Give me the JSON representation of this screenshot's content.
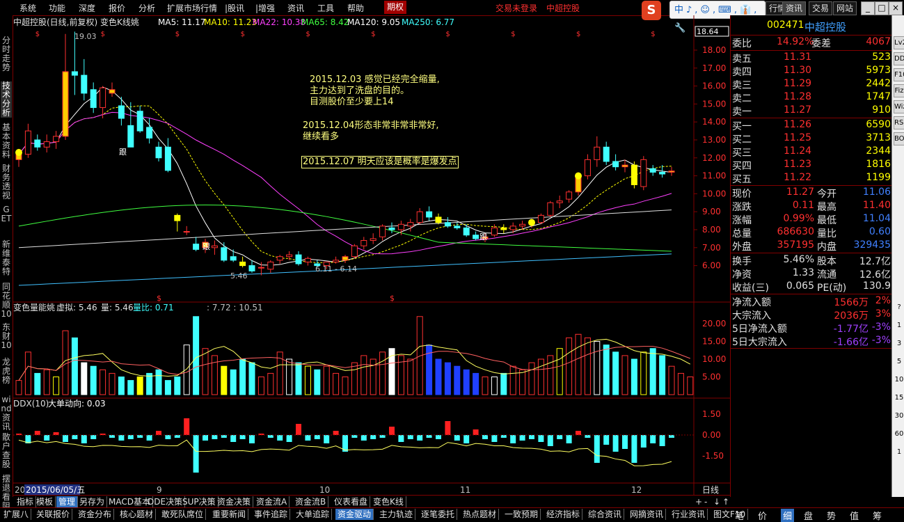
{
  "menu": {
    "items": [
      "系统",
      "功能",
      "深度",
      "报价",
      "分析",
      "扩展市场行情",
      "|股讯",
      "|增强",
      "资讯",
      "工具",
      "帮助"
    ],
    "futures": "期权",
    "status": "交易未登录",
    "stock_name": "中超控股",
    "ime": "中♪,☺,⌨,👔,🔧",
    "tabs": [
      "行情",
      "资讯",
      "交易",
      "网站"
    ],
    "win_buttons": [
      "_",
      "□",
      "×"
    ]
  },
  "left_tabs": [
    "分时走势",
    "技术分析",
    "基本资料",
    "财务透视",
    "GET",
    "新维泰特",
    "同花顺10",
    "东财10",
    "龙虎榜",
    "wind资讯",
    "散户查股",
    "摆退看阻"
  ],
  "main_chart": {
    "title": "中超控股(日线,前复权) 变色K线姚",
    "ma": [
      {
        "label": "MA5: 11.17",
        "color": "#ffffff"
      },
      {
        "label": "MA10: 11.23",
        "color": "#ffff00"
      },
      {
        "label": "MA22: 10.38",
        "color": "#ff40ff"
      },
      {
        "label": "MA65: 8.42",
        "color": "#40ff40"
      },
      {
        "label": "MA120: 9.05",
        "color": "#ffffff"
      },
      {
        "label": "MA250: 6.77",
        "color": "#40ffff"
      }
    ],
    "price_box": "18.64",
    "high_label": "19.03",
    "low_label": "5.46",
    "low2_label": "6.11 - 6.14",
    "follow_label": "跟",
    "y_ticks": [
      "18.00",
      "17.00",
      "16.00",
      "15.00",
      "14.00",
      "13.00",
      "12.00",
      "11.00",
      "10.00",
      "9.00",
      "8.00",
      "7.00",
      "6.00"
    ],
    "annotations": [
      {
        "lines": [
          "2015.12.03 感觉已经完全缩量,",
          "主力达到了洗盘的目的。",
          "目测股价至少要上14"
        ]
      },
      {
        "lines": [
          "2015.12.04形态非常非常非常好,",
          "继续看多"
        ]
      },
      {
        "lines": [
          "2015.12.07 明天应该是概率是爆发点"
        ]
      }
    ]
  },
  "volume_chart": {
    "title": "变色量能姚",
    "virtual": "虚拟: 5.46",
    "vol": "量: 5.46",
    "ratio": "量比: 0.71",
    "extra": ": 7.72 : 10.51",
    "y_ticks": [
      "20.00",
      "15.00",
      "10.00",
      "5.00"
    ]
  },
  "ddx_chart": {
    "title": "DDX(10)",
    "big": "大单动向: 0.03",
    "y_ticks": [
      "1.50",
      "0.00",
      "-1.50"
    ]
  },
  "x_axis": {
    "start": "20",
    "date": "2015/06/05/五",
    "months": [
      "9",
      "10",
      "11",
      "12"
    ],
    "period": "日线"
  },
  "chart_data": {
    "type": "candlestick",
    "title": "中超控股(日线,前复权) 变色K线姚",
    "ylim": [
      5.4,
      18.6
    ],
    "candles": [
      [
        11.9,
        12.5,
        11.5,
        12.2
      ],
      [
        12.2,
        13.9,
        12.0,
        13.5
      ],
      [
        13.0,
        13.3,
        12.4,
        12.6
      ],
      [
        12.6,
        13.3,
        12.3,
        12.9
      ],
      [
        12.9,
        13.5,
        12.5,
        13.2
      ],
      [
        13.2,
        18.9,
        13.0,
        16.8
      ],
      [
        16.8,
        19.03,
        15.5,
        16.6
      ],
      [
        16.6,
        17.5,
        15.2,
        15.6
      ],
      [
        15.8,
        16.2,
        14.5,
        14.8
      ],
      [
        14.8,
        16.0,
        14.2,
        15.9
      ],
      [
        15.6,
        16.2,
        15.4,
        15.8
      ],
      [
        14.9,
        15.4,
        13.8,
        14.2
      ],
      [
        13.8,
        15.1,
        12.7,
        12.6
      ],
      [
        14.6,
        14.9,
        13.4,
        13.5
      ],
      [
        13.7,
        14.2,
        12.8,
        13.1
      ],
      [
        12.6,
        12.9,
        11.8,
        12.0
      ],
      [
        12.6,
        13.1,
        11.2,
        11.3
      ],
      [
        8.8,
        8.9,
        7.9,
        8.5
      ],
      [
        7.9,
        8.2,
        7.7,
        7.9
      ],
      [
        7.2,
        7.6,
        6.8,
        6.9
      ],
      [
        7.0,
        7.5,
        6.7,
        7.3
      ],
      [
        7.0,
        7.4,
        6.6,
        7.1
      ],
      [
        7.0,
        7.3,
        6.2,
        6.3
      ],
      [
        6.5,
        6.9,
        6.2,
        6.3
      ],
      [
        6.2,
        6.5,
        5.9,
        6.0
      ],
      [
        6.0,
        6.3,
        5.6,
        5.7
      ],
      [
        5.9,
        6.2,
        5.46,
        5.9
      ],
      [
        5.8,
        6.3,
        5.6,
        6.2
      ],
      [
        6.3,
        6.6,
        6.1,
        6.5
      ],
      [
        6.5,
        6.8,
        6.3,
        6.6
      ],
      [
        6.6,
        6.8,
        6.0,
        6.1
      ],
      [
        6.2,
        6.5,
        6.0,
        6.4
      ],
      [
        6.1,
        6.3,
        5.9,
        6.0
      ],
      [
        6.0,
        6.2,
        5.8,
        6.2
      ],
      [
        6.2,
        6.5,
        6.11,
        6.3
      ],
      [
        6.3,
        6.6,
        6.14,
        6.5
      ],
      [
        6.5,
        7.2,
        6.4,
        7.1
      ],
      [
        7.1,
        7.6,
        6.9,
        7.4
      ],
      [
        7.4,
        7.8,
        7.2,
        7.5
      ],
      [
        7.6,
        8.3,
        7.4,
        8.2
      ],
      [
        8.1,
        8.4,
        7.8,
        8.0
      ],
      [
        8.0,
        8.5,
        7.7,
        8.3
      ],
      [
        8.2,
        8.6,
        7.9,
        8.4
      ],
      [
        8.4,
        9.2,
        8.3,
        9.0
      ],
      [
        9.0,
        9.3,
        8.5,
        8.7
      ],
      [
        8.7,
        8.9,
        8.3,
        8.4
      ],
      [
        8.4,
        8.7,
        8.1,
        8.2
      ],
      [
        8.2,
        8.4,
        8.0,
        8.1
      ],
      [
        8.1,
        8.3,
        7.6,
        7.7
      ],
      [
        7.7,
        7.9,
        7.4,
        7.5
      ],
      [
        7.5,
        7.8,
        7.3,
        7.6
      ],
      [
        7.7,
        8.3,
        7.6,
        8.1
      ],
      [
        8.1,
        8.3,
        7.8,
        8.0
      ],
      [
        8.0,
        8.4,
        7.8,
        8.2
      ],
      [
        8.2,
        8.5,
        8.0,
        8.3
      ],
      [
        8.3,
        8.6,
        8.1,
        8.4
      ],
      [
        8.4,
        8.9,
        8.3,
        8.8
      ],
      [
        8.8,
        9.6,
        8.7,
        9.5
      ],
      [
        9.5,
        9.9,
        9.2,
        9.6
      ],
      [
        9.7,
        10.2,
        9.5,
        10.1
      ],
      [
        10.1,
        11.2,
        9.9,
        11.0
      ],
      [
        11.0,
        12.2,
        10.8,
        11.9
      ],
      [
        11.9,
        13.2,
        11.5,
        12.6
      ],
      [
        12.6,
        12.9,
        11.6,
        11.8
      ],
      [
        11.8,
        12.2,
        11.3,
        11.5
      ],
      [
        11.5,
        11.9,
        11.2,
        11.6
      ],
      [
        11.6,
        11.8,
        10.3,
        10.5
      ],
      [
        10.4,
        12.1,
        10.2,
        11.9
      ],
      [
        11.4,
        11.6,
        11.0,
        11.2
      ],
      [
        11.2,
        11.6,
        10.9,
        11.1
      ],
      [
        11.2,
        11.5,
        11.0,
        11.27
      ]
    ],
    "volume": [
      4,
      12,
      6,
      7,
      5,
      18,
      16,
      9,
      8,
      7,
      6,
      5,
      4,
      5,
      6,
      7,
      4,
      5,
      14,
      22,
      13,
      11,
      8,
      7,
      10,
      9,
      5,
      6,
      12,
      10,
      9,
      8,
      7,
      8,
      6,
      5,
      9,
      11,
      10,
      12,
      13,
      11,
      10,
      22,
      14,
      10,
      9,
      8,
      7,
      6,
      5,
      5,
      6,
      8,
      7,
      9,
      10,
      11,
      13,
      16,
      17,
      16,
      15,
      14,
      12,
      11,
      10,
      12,
      13,
      11,
      8,
      6,
      5
    ],
    "ddx": [
      0.1,
      -0.6,
      0.3,
      -0.4,
      0.2,
      -0.5,
      -0.3,
      -0.6,
      -0.3,
      0.1,
      -0.2,
      -0.4,
      -0.3,
      -0.2,
      -0.4,
      0.3,
      -0.3,
      -0.2,
      1.2,
      -2.7,
      -0.4,
      -0.3,
      -0.2,
      -0.5,
      -0.3,
      -0.6,
      0.1,
      -0.2,
      -0.4,
      -0.5,
      0.8,
      -0.4,
      -0.3,
      -0.6,
      0.3,
      -1.2,
      -0.2,
      -0.4,
      -0.3,
      -0.2,
      0.6,
      -0.5,
      -0.3,
      -0.4,
      -0.2,
      -0.3,
      1.0,
      -0.4,
      -0.6,
      0.4,
      -0.3,
      -0.5,
      -0.2,
      -0.6,
      -0.4,
      -0.3,
      -0.5,
      -0.8,
      -0.3,
      -0.6,
      0.3,
      -0.2,
      -2.0,
      -0.7,
      -1.2,
      -1.0,
      -2.0,
      -0.9,
      -0.6,
      -0.8,
      -0.2
    ]
  },
  "quote": {
    "code": "002471",
    "name": "中超控股",
    "wb_label": "委比",
    "wb_val": "14.92%",
    "wc_label": "委差",
    "wc_val": "4067",
    "sells": [
      {
        "label": "卖五",
        "price": "11.31",
        "vol": "523"
      },
      {
        "label": "卖四",
        "price": "11.30",
        "vol": "5973"
      },
      {
        "label": "卖三",
        "price": "11.29",
        "vol": "2442"
      },
      {
        "label": "卖二",
        "price": "11.28",
        "vol": "1747"
      },
      {
        "label": "卖一",
        "price": "11.27",
        "vol": "910"
      }
    ],
    "buys": [
      {
        "label": "买一",
        "price": "11.26",
        "vol": "6590"
      },
      {
        "label": "买二",
        "price": "11.25",
        "vol": "3713"
      },
      {
        "label": "买三",
        "price": "11.24",
        "vol": "2344"
      },
      {
        "label": "买四",
        "price": "11.23",
        "vol": "1816"
      },
      {
        "label": "买五",
        "price": "11.22",
        "vol": "1199"
      }
    ],
    "stats": [
      {
        "l1": "现价",
        "v1": "11.27",
        "l2": "今开",
        "v2": "11.06",
        "c2": "#4080ff"
      },
      {
        "l1": "涨跌",
        "v1": "0.11",
        "l2": "最高",
        "v2": "11.40",
        "c2": "#ff3030"
      },
      {
        "l1": "涨幅",
        "v1": "0.99%",
        "l2": "最低",
        "v2": "11.04",
        "c2": "#4080ff"
      },
      {
        "l1": "总量",
        "v1": "686630",
        "l2": "量比",
        "v2": "0.60",
        "c2": "#4080ff"
      },
      {
        "l1": "外盘",
        "v1": "357195",
        "l2": "内盘",
        "v2": "329435",
        "c2": "#4080ff"
      }
    ],
    "stats2": [
      {
        "l1": "换手",
        "v1": "5.46%",
        "l2": "股本",
        "v2": "12.7亿"
      },
      {
        "l1": "净资",
        "v1": "1.33",
        "l2": "流通",
        "v2": "12.6亿"
      },
      {
        "l1": "收益(三)",
        "v1": "0.065",
        "l2": "PE(动)",
        "v2": "130.9"
      }
    ],
    "flows": [
      {
        "label": "净流入额",
        "val": "1566万",
        "pct": "2%",
        "color": "#ff3030"
      },
      {
        "label": "大宗流入",
        "val": "2036万",
        "pct": "3%",
        "color": "#ff3030"
      },
      {
        "label": "5日净流入额",
        "val": "-1.77亿",
        "pct": "-3%",
        "color": "#a040ff"
      },
      {
        "label": "5日大宗流入",
        "val": "-1.66亿",
        "pct": "-3%",
        "color": "#a040ff"
      }
    ]
  },
  "right_strip": [
    "?",
    "1",
    "3",
    "5",
    "10",
    "15",
    "30",
    "60",
    "1"
  ],
  "right_strip_icons": [
    "Lv2",
    "DDE",
    "F10",
    "Fiz",
    "Wiz",
    "RSI",
    "BOL"
  ],
  "bottom_tabs": [
    "指标",
    "模板",
    "管理",
    "另存为",
    "MACD基本",
    "DDE决策",
    "SUP决策",
    "资金决策",
    "资金流A",
    "资金流B",
    "仪表看盘",
    "变色K线"
  ],
  "bottom_ctrl": [
    "+",
    "-",
    "↓",
    "↑"
  ],
  "bottom2_tabs": [
    "扩展八",
    "关联报价",
    "资金分布",
    "核心题材",
    "敢死队席位",
    "重要新闻",
    "事件追踪",
    "大单追踪",
    "资金驱动",
    "主力轨迹",
    "逐笔委托",
    "热点题材",
    "一致预期",
    "经济指标",
    "综合资讯",
    "网摘资讯",
    "行业资讯",
    "图文F10"
  ],
  "bottom2_right": [
    "笔",
    "价",
    "细",
    "盘",
    "势",
    "值",
    "筹"
  ]
}
